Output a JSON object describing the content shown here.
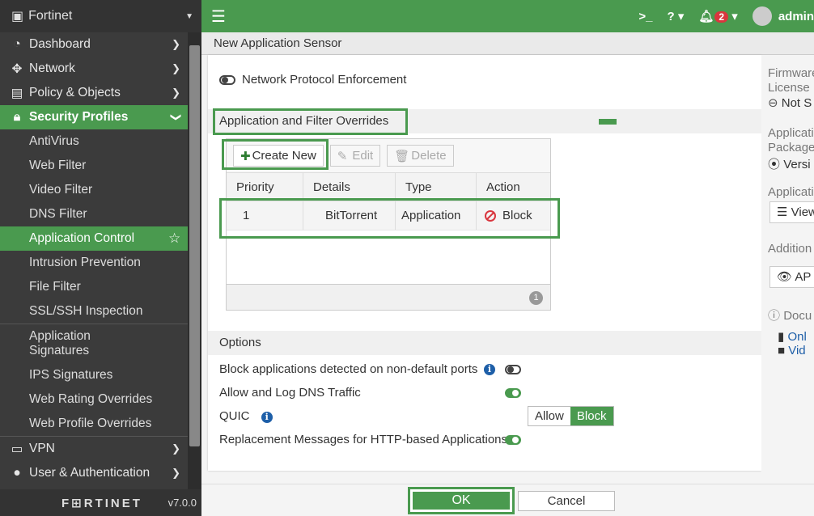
{
  "sidebar": {
    "app_name": "Fortinet",
    "items": [
      {
        "label": "Dashboard"
      },
      {
        "label": "Network"
      },
      {
        "label": "Policy & Objects"
      },
      {
        "label": "Security Profiles"
      },
      {
        "label": "VPN"
      },
      {
        "label": "User & Authentication"
      }
    ],
    "sub": [
      {
        "label": "AntiVirus"
      },
      {
        "label": "Web Filter"
      },
      {
        "label": "Video Filter"
      },
      {
        "label": "DNS Filter"
      },
      {
        "label": "Application Control"
      },
      {
        "label": "Intrusion Prevention"
      },
      {
        "label": "File Filter"
      },
      {
        "label": "SSL/SSH Inspection"
      },
      {
        "label": "Application Signatures"
      },
      {
        "label": "IPS Signatures"
      },
      {
        "label": "Web Rating Overrides"
      },
      {
        "label": "Web Profile Overrides"
      }
    ],
    "logo": "F⊞RTINET",
    "version": "v7.0.0"
  },
  "topbar": {
    "notifications": "2",
    "user": "admin"
  },
  "page": {
    "title": "New Application Sensor"
  },
  "main": {
    "npe_label": "Network Protocol Enforcement",
    "overrides_title": "Application and Filter Overrides",
    "toolbar": {
      "create": "Create New",
      "edit": "Edit",
      "delete": "Delete"
    },
    "columns": [
      "Priority",
      "Details",
      "Type",
      "Action"
    ],
    "rows": [
      {
        "priority": "1",
        "details": "BitTorrent",
        "type": "Application",
        "action": "Block"
      }
    ],
    "page_count": "1",
    "options_title": "Options",
    "opt_nondefault": "Block applications detected on non-default ports",
    "opt_dns": "Allow and Log DNS Traffic",
    "opt_quic": "QUIC",
    "quic_allow": "Allow",
    "quic_block": "Block",
    "opt_replacement": "Replacement Messages for HTTP-based Applications"
  },
  "right": {
    "firmware": "Firmware",
    "license": "License",
    "not": "Not S",
    "application": "Applicati",
    "package": "Package",
    "version": "Versi",
    "application2": "Applicati",
    "view": "View",
    "additional": "Addition",
    "ap": "AP",
    "docs": "Docu",
    "online": "Onl",
    "video": "Vid"
  },
  "footer": {
    "ok": "OK",
    "cancel": "Cancel"
  },
  "colors": {
    "accent": "#4a9a4f",
    "sidebar": "#3b3b3b",
    "block": "#d9363e"
  }
}
